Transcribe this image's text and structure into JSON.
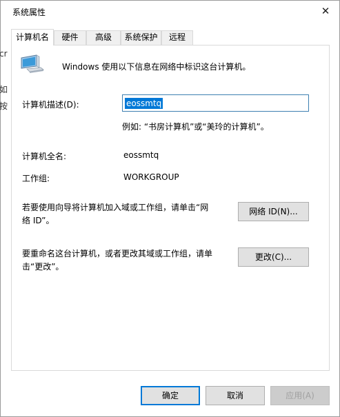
{
  "window": {
    "title": "系统属性",
    "close_glyph": "✕"
  },
  "background_fragments": [
    "cr",
    "如",
    "按"
  ],
  "tabs": [
    {
      "label": "计算机名",
      "active": true
    },
    {
      "label": "硬件",
      "active": false
    },
    {
      "label": "高级",
      "active": false
    },
    {
      "label": "系统保护",
      "active": false
    },
    {
      "label": "远程",
      "active": false
    }
  ],
  "main": {
    "intro_text": "Windows 使用以下信息在网络中标识这台计算机。",
    "description_label": "计算机描述(D):",
    "description_value": "eossmtq",
    "example_text": "例如: “书房计算机”或“美玲的计算机”。",
    "fullname_label": "计算机全名:",
    "fullname_value": "eossmtq",
    "workgroup_label": "工作组:",
    "workgroup_value": "WORKGROUP",
    "network_text": "若要使用向导将计算机加入域或工作组，请单击“网络 ID”。",
    "network_button": "网络 ID(N)...",
    "rename_text": "要重命名这台计算机，或者更改其域或工作组，请单击“更改”。",
    "change_button": "更改(C)..."
  },
  "footer": {
    "ok_button": "确定",
    "cancel_button": "取消",
    "apply_button": "应用(A)"
  },
  "icons": {
    "computer": "computer-icon",
    "close": "close-icon"
  },
  "colors": {
    "accent": "#0078d7",
    "tab_border": "#d9d9d9",
    "button_face": "#e1e1e1"
  }
}
